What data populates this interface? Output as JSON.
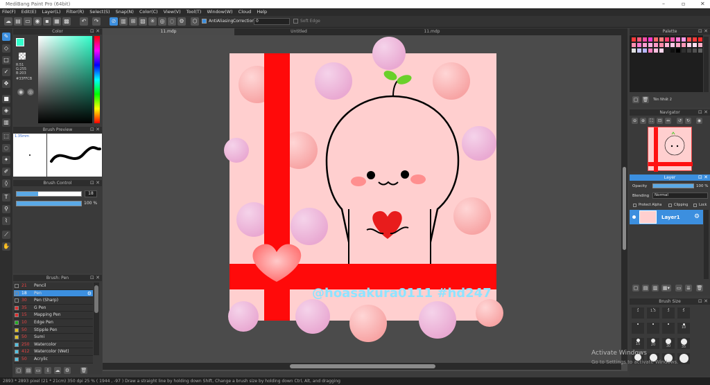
{
  "window": {
    "title": "MediBang Paint Pro (64bit)"
  },
  "menu": [
    "File(F)",
    "Edit(E)",
    "Layer(L)",
    "Filter(R)",
    "Select(S)",
    "Snap(N)",
    "Color(C)",
    "View(V)",
    "Tool(T)",
    "Window(W)",
    "Cloud",
    "Help"
  ],
  "toolbar": {
    "antialias": "AntiAliasing",
    "correction_label": "Correction",
    "correction_value": "0",
    "soft_edge": "Soft Edge"
  },
  "color_panel": {
    "title": "Color",
    "r": "R:51",
    "g": "G:255",
    "b": "B:203",
    "hex": "#33FFCB",
    "current": "#33ffcb"
  },
  "brush_preview": {
    "title": "Brush Preview",
    "size": "1.35mm"
  },
  "brush_control": {
    "title": "Brush Control",
    "size_value": "18",
    "opacity_value": "100 %",
    "size_fill": 0.33,
    "opacity_fill": 1.0
  },
  "brush_list": {
    "title": "Brush: Pen",
    "items": [
      {
        "size": "21",
        "name": "Pencil",
        "color": "#333333"
      },
      {
        "size": "18",
        "name": "Pen",
        "color": "#3c8fdf"
      },
      {
        "size": "30",
        "name": "Pen (Sharp)",
        "color": "#333333"
      },
      {
        "size": "35",
        "name": "G Pen",
        "color": "#e03030"
      },
      {
        "size": "15",
        "name": "Mapping Pen",
        "color": "#e03030"
      },
      {
        "size": "10",
        "name": "Edge Pen",
        "color": "#22aa22"
      },
      {
        "size": "50",
        "name": "Stipple Pen",
        "color": "#e0c020"
      },
      {
        "size": "50",
        "name": "Sumi",
        "color": "#e0c020"
      },
      {
        "size": "250",
        "name": "Watercolor",
        "color": "#50c0e0"
      },
      {
        "size": "412",
        "name": "Watercolor (Wet)",
        "color": "#50c0e0"
      },
      {
        "size": "50",
        "name": "Acrylic",
        "color": "#50c0e0"
      }
    ]
  },
  "tabs": [
    {
      "label": "11.mdp"
    },
    {
      "label": "Untitled"
    },
    {
      "label": "11.mdp"
    }
  ],
  "artwork": {
    "caption": "@hoasakura0111   #hd247"
  },
  "palette": {
    "title": "Palette",
    "name": "Tên Nhất 2"
  },
  "navigator": {
    "title": "Navigator"
  },
  "layer_panel": {
    "title": "Layer",
    "opacity_label": "Opacity",
    "opacity_value": "100 %",
    "blending_label": "Blending",
    "blending_value": "Normal",
    "protect_alpha": "Protect Alpha",
    "clipping": "Clipping",
    "lock": "Lock",
    "layer_name": "Layer1"
  },
  "brush_size": {
    "title": "Brush Size",
    "sizes": [
      "1",
      "1.5",
      "3",
      "5",
      "",
      "",
      "",
      "10",
      "15",
      "20",
      "30",
      "35"
    ]
  },
  "status": {
    "text": "2893 * 2893 pixel  (21 * 21cm)  350 dpi  25 %  ( 1944 , -97 )  Draw a straight line by holding down Shift, Change a brush size by holding down Ctrl, Alt, and dragging"
  },
  "watermark": {
    "line1": "Activate Windows",
    "line2": "Go to Settings to activate Windows."
  }
}
